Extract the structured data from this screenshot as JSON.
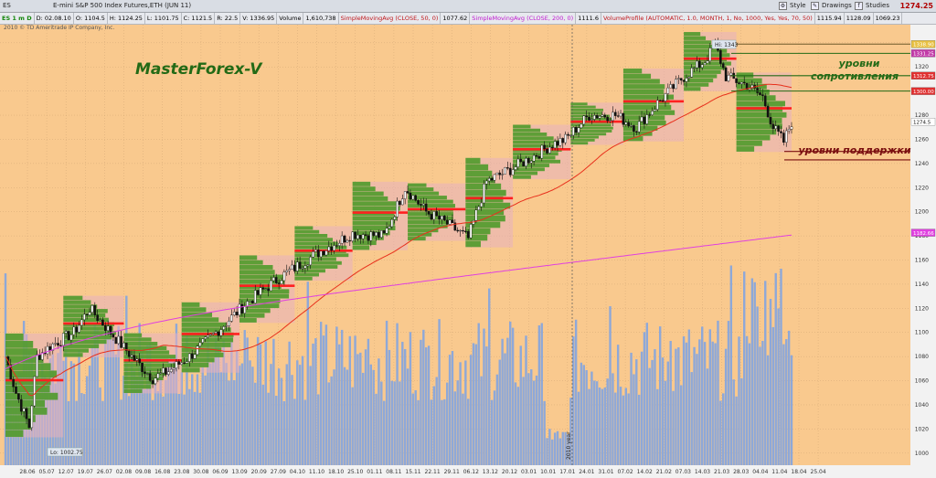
{
  "topbar": {
    "symbol": "ES",
    "instrument_title": "E-mini S&P 500 Index Futures,ETH (JUN 11)",
    "style_label": "Style",
    "drawings_label": "Drawings",
    "studies_label": "Studies",
    "last_price": "1274.25"
  },
  "infobar": {
    "tf": "ES 1 m D",
    "d": "D: 02.08.10",
    "o": "O: 1104.5",
    "h": "H: 1124.25",
    "l": "L: 1101.75",
    "c": "C: 1121.5",
    "r": "R: 22.5",
    "v": "V: 1336.95",
    "volume_label": "Volume",
    "volume_value": "1,610,738",
    "sma50_label": "SimpleMovingAvg (CLOSE, 50, 0)",
    "sma50_value": "1077.62",
    "sma200_label": "SimpleMovingAvg (CLOSE, 200, 0)",
    "sma200_value": "1111.6",
    "vp_label": "VolumeProfile (AUTOMATIC, 1.0, MONTH, 1, No, 1000, Yes, Yes, 70, 50)",
    "vp_v1": "1115.94",
    "vp_v2": "1128.09",
    "vp_v3": "1069.23"
  },
  "copyright": "2010 © TD Ameritrade IP Company, Inc.",
  "annotations": {
    "watermark": "MasterForex-V",
    "resistance": [
      "уровни",
      "сопротивления"
    ],
    "support": "уровни поддержки",
    "high_label": "Hi: 1343",
    "low_label": "Lo: 1002.75",
    "year_label": "2010 year"
  },
  "colors": {
    "background": "#f9c98e",
    "bull": "#ffffff",
    "bear": "#111111",
    "volume_bars": "#8ea8d8",
    "profile_green": "#4e9a2a",
    "profile_pink": "#e8b0c0",
    "poc_red": "#ff2020",
    "sma50": "#e8301c",
    "sma200": "#e040e0"
  },
  "price_tags": {
    "res1": "1338.90",
    "res2": "1331.25",
    "res3": "1312.75",
    "res4": "1300.00",
    "last": "1274.5",
    "sma200": "1182.66"
  },
  "chart_data": {
    "type": "candlestick",
    "title": "E-mini S&P 500 Index Futures,ETH (JUN 11)",
    "ylim": [
      990,
      1355
    ],
    "yticks": [
      1000,
      1020,
      1040,
      1060,
      1080,
      1100,
      1120,
      1140,
      1160,
      1180,
      1200,
      1220,
      1240,
      1260,
      1280,
      1300,
      1320,
      1340
    ],
    "xtick_labels": [
      "28.06",
      "05.07",
      "12.07",
      "19.07",
      "26.07",
      "02.08",
      "09.08",
      "16.08",
      "23.08",
      "30.08",
      "06.09",
      "13.09",
      "20.09",
      "27.09",
      "04.10",
      "11.10",
      "18.10",
      "25.10",
      "01.11",
      "08.11",
      "15.11",
      "22.11",
      "29.11",
      "06.12",
      "13.12",
      "20.12",
      "03.01",
      "10.01",
      "17.01",
      "24.01",
      "31.01",
      "07.02",
      "14.02",
      "21.02",
      "07.03",
      "14.03",
      "21.03",
      "28.03",
      "04.04",
      "11.04",
      "18.04",
      "25.04"
    ],
    "close_anchors": [
      [
        0,
        1080
      ],
      [
        4,
        1050
      ],
      [
        9,
        1022
      ],
      [
        12,
        1080
      ],
      [
        18,
        1090
      ],
      [
        26,
        1100
      ],
      [
        32,
        1120
      ],
      [
        40,
        1100
      ],
      [
        48,
        1080
      ],
      [
        56,
        1062
      ],
      [
        62,
        1068
      ],
      [
        70,
        1080
      ],
      [
        80,
        1100
      ],
      [
        92,
        1125
      ],
      [
        104,
        1145
      ],
      [
        118,
        1165
      ],
      [
        132,
        1182
      ],
      [
        144,
        1180
      ],
      [
        152,
        1220
      ],
      [
        160,
        1200
      ],
      [
        168,
        1190
      ],
      [
        176,
        1178
      ],
      [
        183,
        1225
      ],
      [
        192,
        1235
      ],
      [
        200,
        1245
      ],
      [
        208,
        1256
      ],
      [
        213,
        1260
      ],
      [
        222,
        1280
      ],
      [
        232,
        1280
      ],
      [
        240,
        1270
      ],
      [
        248,
        1290
      ],
      [
        258,
        1312
      ],
      [
        266,
        1325
      ],
      [
        270,
        1338
      ],
      [
        274,
        1312
      ],
      [
        282,
        1305
      ],
      [
        288,
        1295
      ],
      [
        292,
        1270
      ],
      [
        296,
        1258
      ],
      [
        299,
        1274.5
      ]
    ],
    "volume_hint": "relative daily volume bars",
    "resistance_levels": [
      1338.9,
      1331.25,
      1312.75,
      1300
    ],
    "support_levels": [
      1250,
      1243
    ],
    "high": 1343,
    "low": 1002.75
  }
}
